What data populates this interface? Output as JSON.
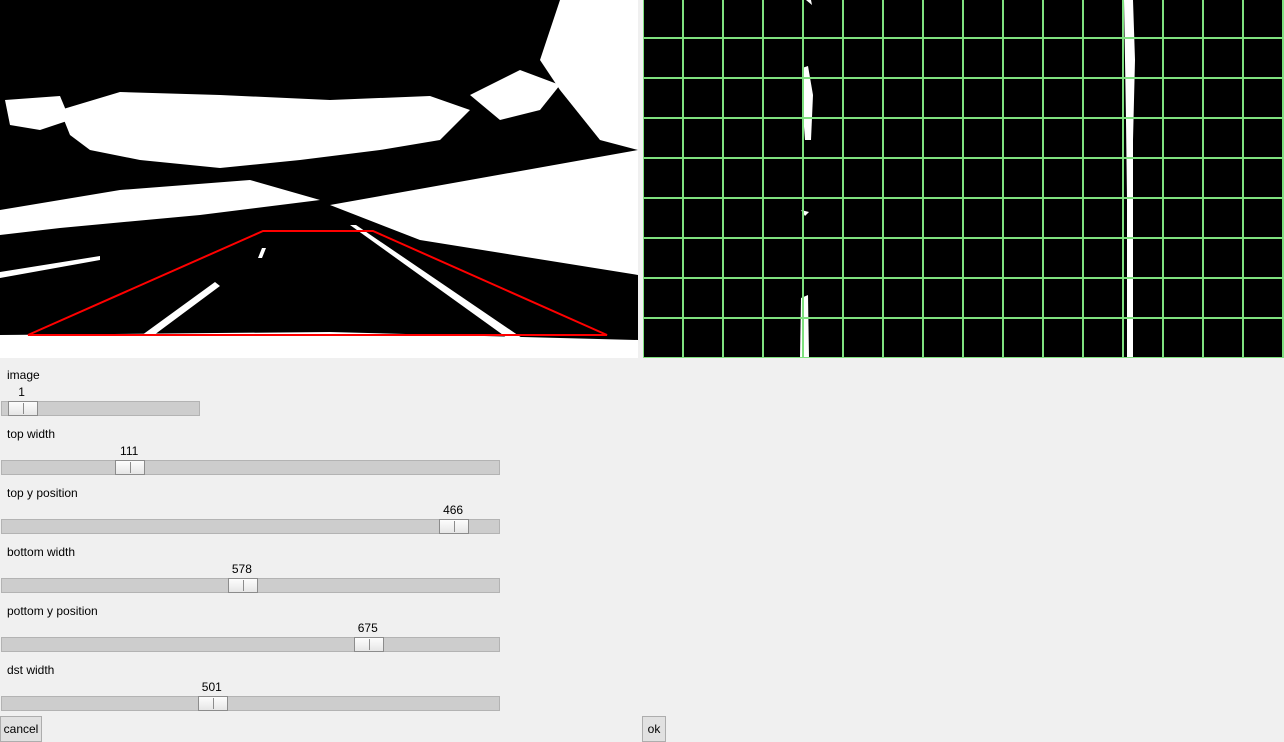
{
  "preview": {
    "roi_color": "#ff0000",
    "grid_color": "#7fe07f"
  },
  "sliders": [
    {
      "label": "image",
      "value": "1",
      "min": 0,
      "max": 30
    },
    {
      "label": "top width",
      "value": "111",
      "min": 0,
      "max": 460
    },
    {
      "label": "top y position",
      "value": "466",
      "min": 0,
      "max": 500
    },
    {
      "label": "bottom width",
      "value": "578",
      "min": 0,
      "max": 1200
    },
    {
      "label": "pottom y position",
      "value": "675",
      "min": 0,
      "max": 900
    },
    {
      "label": "dst width",
      "value": "501",
      "min": 0,
      "max": 1200
    }
  ],
  "buttons": {
    "cancel": "cancel",
    "ok": "ok"
  }
}
